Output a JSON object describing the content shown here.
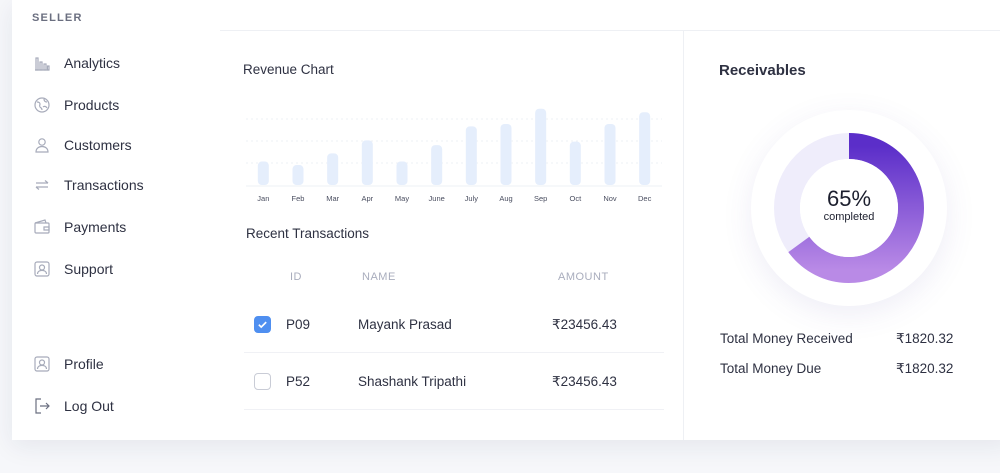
{
  "sidebar": {
    "brand": "SELLER",
    "items": [
      {
        "label": "Analytics",
        "icon": "bar-chart-icon"
      },
      {
        "label": "Products",
        "icon": "globe-icon"
      },
      {
        "label": "Customers",
        "icon": "user-icon"
      },
      {
        "label": "Transactions",
        "icon": "transfer-arrows-icon"
      },
      {
        "label": "Payments",
        "icon": "wallet-icon"
      },
      {
        "label": "Support",
        "icon": "support-icon"
      }
    ],
    "bottom_items": [
      {
        "label": "Profile",
        "icon": "profile-icon"
      },
      {
        "label": "Log Out",
        "icon": "logout-icon"
      }
    ]
  },
  "revenue": {
    "title": "Revenue Chart"
  },
  "chart_data": {
    "type": "bar",
    "title": "Revenue Chart",
    "categories": [
      "Jan",
      "Feb",
      "Mar",
      "Apr",
      "May",
      "June",
      "July",
      "Aug",
      "Sep",
      "Oct",
      "Nov",
      "Dec"
    ],
    "values": [
      20,
      17,
      27,
      38,
      20,
      34,
      50,
      52,
      65,
      37,
      52,
      62
    ],
    "ylim": [
      0,
      75
    ],
    "grid": true,
    "bar_color": "#e5eefc"
  },
  "transactions": {
    "title": "Recent Transactions",
    "columns": {
      "id": "ID",
      "name": "NAME",
      "amount": "AMOUNT"
    },
    "rows": [
      {
        "id": "P09",
        "name": "Mayank Prasad",
        "amount": "₹23456.43",
        "checked": true
      },
      {
        "id": "P52",
        "name": "Shashank Tripathi",
        "amount": "₹23456.43",
        "checked": false
      }
    ]
  },
  "receivables": {
    "title": "Receivables",
    "percent": 65,
    "percent_text": "65%",
    "percent_sub": "completed",
    "track_color": "#efedfb",
    "gradient_start": "#b98ae6",
    "gradient_end": "#5b2ec9",
    "rows": [
      {
        "label": "Total Money Received",
        "value": "₹1820.32"
      },
      {
        "label": "Total Money Due",
        "value": "₹1820.32"
      }
    ]
  }
}
